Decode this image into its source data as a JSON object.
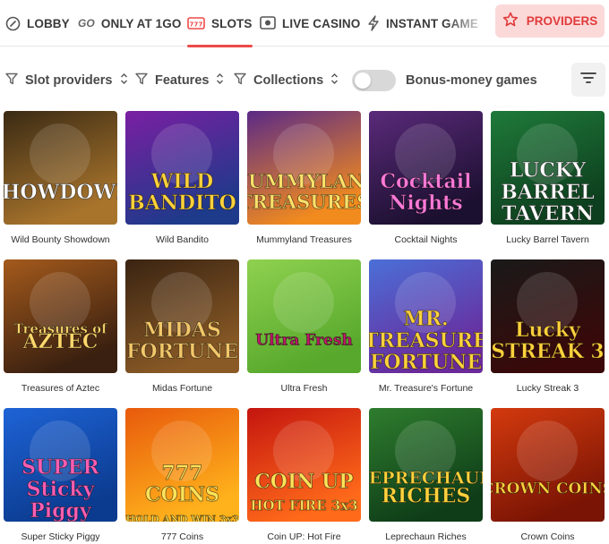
{
  "nav": {
    "items": [
      {
        "label": "LOBBY",
        "icon": "lobby-icon"
      },
      {
        "label": "ONLY AT 1GO",
        "icon": "go-icon"
      },
      {
        "label": "SLOTS",
        "icon": "slot-machine-icon",
        "active": true
      },
      {
        "label": "LIVE CASINO",
        "icon": "live-casino-icon"
      },
      {
        "label": "INSTANT GAMES",
        "icon": "lightning-icon"
      }
    ],
    "go_badge": "GO",
    "providers_label": "PROVIDERS",
    "accent": "#ee4a4a"
  },
  "filters": {
    "slot_providers": "Slot providers",
    "features": "Features",
    "collections": "Collections",
    "bonus_money": "Bonus-money games",
    "bonus_toggle_on": false
  },
  "games": [
    {
      "title": "Wild Bounty Showdown",
      "logo": [
        "SHOWDOWN"
      ],
      "bg": [
        "#3a2a14",
        "#a8742c"
      ],
      "logoColor": "#ffffff"
    },
    {
      "title": "Wild Bandito",
      "logo": [
        "WILD",
        "BANDITO"
      ],
      "bg": [
        "#7b1fa2",
        "#1e3a8a"
      ],
      "logoColor": "#ffd23c"
    },
    {
      "title": "Mummyland Treasures",
      "logo": [
        "MUMMYLAND",
        "TREASURES"
      ],
      "bg": [
        "#5b2a86",
        "#f28b1e"
      ],
      "logoColor": "#ffe16b"
    },
    {
      "title": "Cocktail Nights",
      "logo": [
        "Cocktail",
        "Nights"
      ],
      "bg": [
        "#5a2a7a",
        "#1c1030"
      ],
      "logoColor": "#ff7ad9"
    },
    {
      "title": "Lucky Barrel Tavern",
      "logo": [
        "LUCKY",
        "BARREL",
        "TAVERN"
      ],
      "bg": [
        "#1f7a3a",
        "#0d3f1e"
      ],
      "logoColor": "#ffffff"
    },
    {
      "title": "Treasures of Aztec",
      "logo": [
        "Treasures of",
        "AZTEC"
      ],
      "bg": [
        "#a45a1c",
        "#3a2010"
      ],
      "logoColor": "#ffd86b"
    },
    {
      "title": "Midas Fortune",
      "logo": [
        "MIDAS",
        "FORTUNE"
      ],
      "bg": [
        "#3a2412",
        "#8a5a26"
      ],
      "logoColor": "#f3c76a"
    },
    {
      "title": "Ultra Fresh",
      "logo": [
        "Ultra Fresh"
      ],
      "bg": [
        "#8fd14f",
        "#57a82c"
      ],
      "logoColor": "#c0176b"
    },
    {
      "title": "Mr. Treasure's Fortune",
      "logo": [
        "MR.",
        "TREASURE",
        "FORTUNE"
      ],
      "bg": [
        "#4b6fd8",
        "#6a2a9a"
      ],
      "logoColor": "#ffd23c"
    },
    {
      "title": "Lucky Streak 3",
      "logo": [
        "Lucky",
        "STREAK 3"
      ],
      "bg": [
        "#1a1a1a",
        "#3a0808"
      ],
      "logoColor": "#ffd23c"
    },
    {
      "title": "Super Sticky Piggy",
      "logo": [
        "SUPER",
        "Sticky",
        "Piggy"
      ],
      "bg": [
        "#1e63d6",
        "#0b3b8f"
      ],
      "logoColor": "#ff5fb4"
    },
    {
      "title": "777 Coins",
      "logo": [
        "777",
        "COINS",
        "HOLD AND WIN 3x3"
      ],
      "bg": [
        "#e85a0c",
        "#ffb21c"
      ],
      "logoColor": "#ffe35a"
    },
    {
      "title": "Coin UP: Hot Fire",
      "logo": [
        "COIN UP",
        "HOT FIRE 3x3"
      ],
      "bg": [
        "#c4150f",
        "#ff6a1a"
      ],
      "logoColor": "#ffe35a"
    },
    {
      "title": "Leprechaun Riches",
      "logo": [
        "LEPRECHAUN",
        "RICHES"
      ],
      "bg": [
        "#2e7d2e",
        "#0f3d18"
      ],
      "logoColor": "#ffd23c"
    },
    {
      "title": "Crown Coins",
      "logo": [
        "CROWN COINS"
      ],
      "bg": [
        "#d43a0e",
        "#7a1404"
      ],
      "logoColor": "#ffd23c"
    }
  ]
}
